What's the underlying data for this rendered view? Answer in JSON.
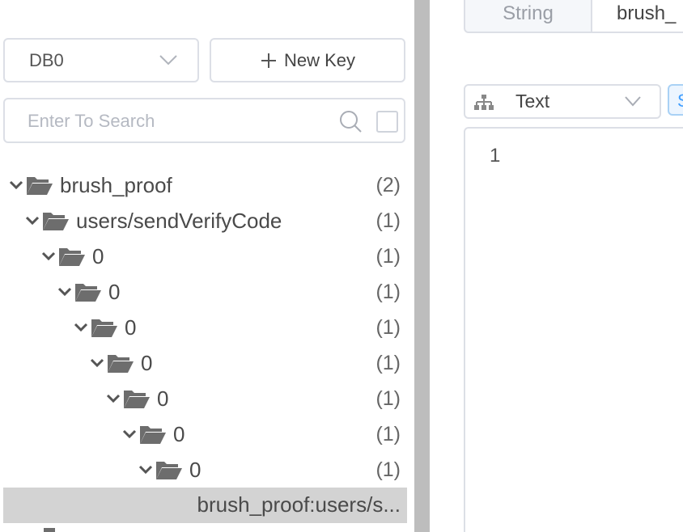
{
  "sidebar": {
    "db_select": {
      "value": "DB0"
    },
    "new_key_label": "New Key",
    "search": {
      "placeholder": "Enter To Search",
      "value": ""
    },
    "tree": [
      {
        "label": "brush_proof",
        "count": "(2)"
      },
      {
        "label": "users/sendVerifyCode",
        "count": "(1)"
      },
      {
        "label": "0",
        "count": "(1)"
      },
      {
        "label": "0",
        "count": "(1)"
      },
      {
        "label": "0",
        "count": "(1)"
      },
      {
        "label": "0",
        "count": "(1)"
      },
      {
        "label": "0",
        "count": "(1)"
      },
      {
        "label": "0",
        "count": "(1)"
      },
      {
        "label": "0",
        "count": "(1)"
      }
    ],
    "selected_key": "brush_proof:users/s..."
  },
  "detail": {
    "type_label": "String",
    "key_name": "brush_",
    "format_value": "Text",
    "size_tag": "S",
    "value_lines": [
      "1"
    ]
  },
  "colors": {
    "divider": "#bdbdbd",
    "selected_row": "#d3d3d3",
    "border": "#dcdfe6",
    "folder_icon": "#6d6d6d",
    "accent": "#409eff"
  }
}
